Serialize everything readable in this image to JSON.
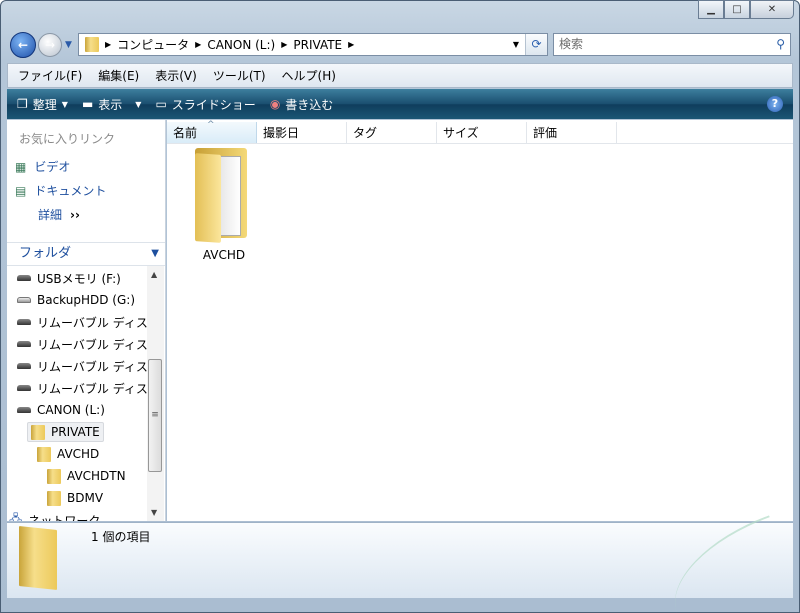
{
  "window": {
    "minimize": "▭",
    "maximize": "□",
    "close": "✕"
  },
  "nav": {
    "back": "←",
    "forward": "→",
    "breadcrumb": [
      "コンピュータ",
      "CANON (L:)",
      "PRIVATE"
    ],
    "search_placeholder": "検索"
  },
  "menu": [
    "ファイル(F)",
    "編集(E)",
    "表示(V)",
    "ツール(T)",
    "ヘルプ(H)"
  ],
  "toolbar": {
    "organize": "整理",
    "view": "表示",
    "slideshow": "スライドショー",
    "burn": "書き込む",
    "help": "?"
  },
  "sidebar": {
    "favorites_header": "お気に入りリンク",
    "links": [
      "ビデオ",
      "ドキュメント",
      "詳細"
    ],
    "folders_header": "フォルダ",
    "tree": [
      {
        "label": "USBメモリ (F:)",
        "type": "drive"
      },
      {
        "label": "BackupHDD (G:)",
        "type": "hdd"
      },
      {
        "label": "リムーバブル ディスク",
        "type": "drive"
      },
      {
        "label": "リムーバブル ディスク",
        "type": "drive"
      },
      {
        "label": "リムーバブル ディスク",
        "type": "drive"
      },
      {
        "label": "リムーバブル ディスク",
        "type": "drive"
      },
      {
        "label": "CANON (L:)",
        "type": "drive"
      },
      {
        "label": "PRIVATE",
        "type": "folder"
      },
      {
        "label": "AVCHD",
        "type": "folder"
      },
      {
        "label": "AVCHDTN",
        "type": "folder"
      },
      {
        "label": "BDMV",
        "type": "folder"
      },
      {
        "label": "ネットワーク",
        "type": "network"
      }
    ]
  },
  "columns": [
    "名前",
    "撮影日",
    "タグ",
    "サイズ",
    "評価"
  ],
  "items": [
    {
      "name": "AVCHD"
    }
  ],
  "details": {
    "count": "1 個の項目"
  }
}
